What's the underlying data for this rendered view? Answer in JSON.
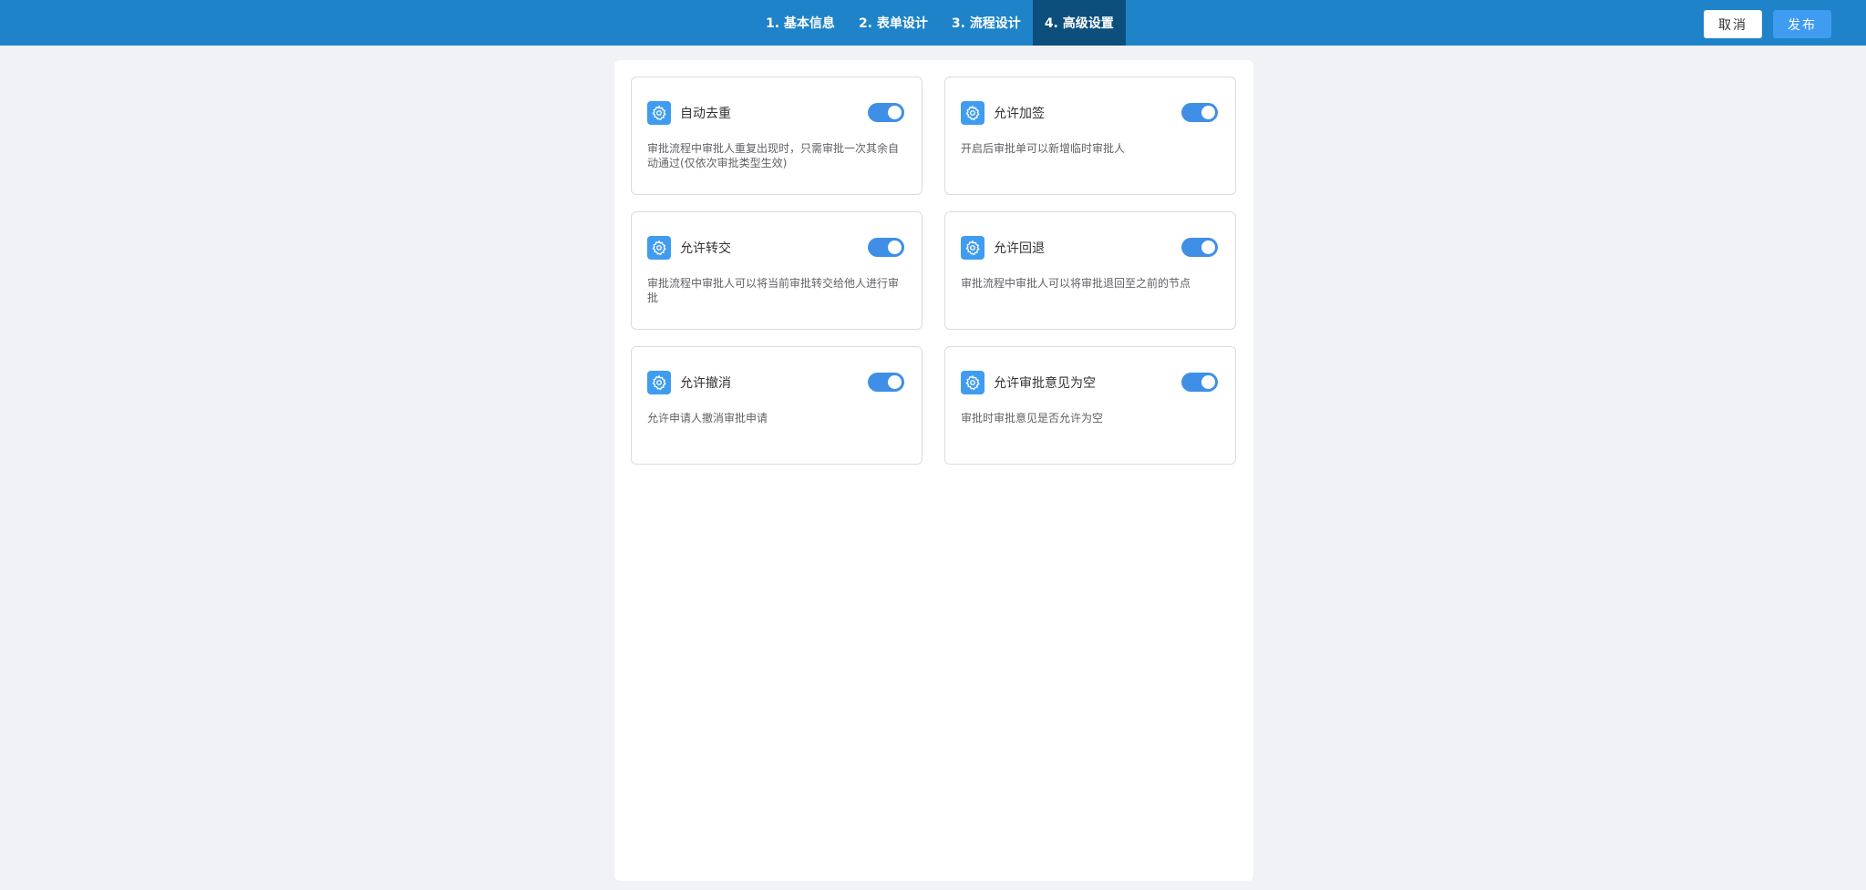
{
  "header": {
    "steps": [
      {
        "label": "1. 基本信息",
        "active": false
      },
      {
        "label": "2. 表单设计",
        "active": false
      },
      {
        "label": "3. 流程设计",
        "active": false
      },
      {
        "label": "4. 高级设置",
        "active": true
      }
    ],
    "cancel_label": "取消",
    "publish_label": "发布"
  },
  "settings": [
    {
      "icon": "gear-icon",
      "title": "自动去重",
      "enabled": true,
      "desc": "审批流程中审批人重复出现时，只需审批一次其余自动通过(仅依次审批类型生效)"
    },
    {
      "icon": "gear-icon",
      "title": "允许加签",
      "enabled": true,
      "desc": "开启后审批单可以新增临时审批人"
    },
    {
      "icon": "gear-icon",
      "title": "允许转交",
      "enabled": true,
      "desc": "审批流程中审批人可以将当前审批转交给他人进行审批"
    },
    {
      "icon": "gear-icon",
      "title": "允许回退",
      "enabled": true,
      "desc": "审批流程中审批人可以将审批退回至之前的节点"
    },
    {
      "icon": "gear-icon",
      "title": "允许撤消",
      "enabled": true,
      "desc": "允许申请人撤消审批申请"
    },
    {
      "icon": "gear-icon",
      "title": "允许审批意见为空",
      "enabled": true,
      "desc": "审批时审批意见是否允许为空"
    }
  ],
  "colors": {
    "header_bg": "#1e83c8",
    "active_step_bg": "#0c4f7c",
    "accent": "#3f9cf0",
    "toggle_on": "#3f8fe6"
  }
}
